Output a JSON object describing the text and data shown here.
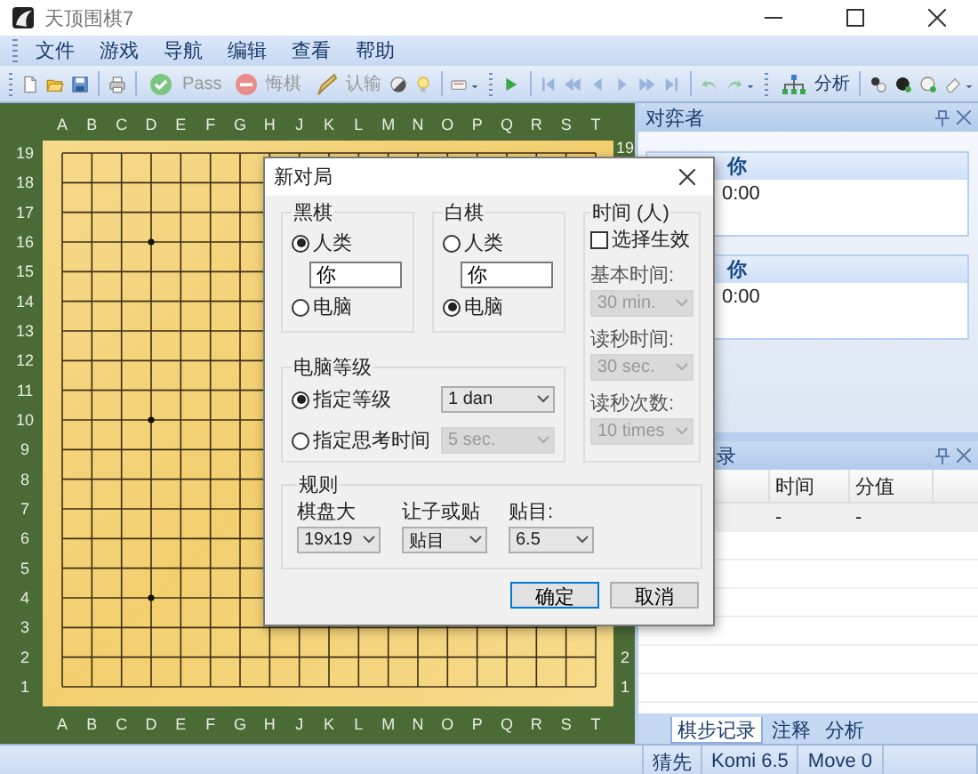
{
  "window": {
    "title": "天顶围棋7"
  },
  "menu": [
    "文件",
    "游戏",
    "导航",
    "编辑",
    "查看",
    "帮助"
  ],
  "toolbar": [
    {
      "label": "Pass",
      "disabled": true
    },
    {
      "label": "悔棋",
      "disabled": true
    },
    {
      "label": "认输",
      "disabled": true
    },
    {
      "label": "分析",
      "disabled": false
    }
  ],
  "board": {
    "top_labels": [
      "A",
      "B",
      "C",
      "D",
      "E",
      "F",
      "G",
      "H",
      "J",
      "K",
      "L",
      "M",
      "N",
      "O",
      "P",
      "Q",
      "R",
      "S",
      "T"
    ],
    "bottom_labels": [
      "A",
      "B",
      "C",
      "D",
      "E",
      "F",
      "G",
      "H",
      "J",
      "K",
      "L",
      "M",
      "N",
      "O",
      "P",
      "Q",
      "R",
      "S",
      "T"
    ],
    "left_labels": [
      "19",
      "18",
      "17",
      "16",
      "15",
      "14",
      "13",
      "12",
      "11",
      "10",
      "9",
      "8",
      "7",
      "6",
      "5",
      "4",
      "3",
      "2",
      "1"
    ],
    "right_labels": [
      "19",
      "2",
      "1"
    ]
  },
  "players_panel": {
    "title": "对弈者",
    "players": [
      {
        "name": "你",
        "time": "0:00"
      },
      {
        "name": "你",
        "time": "0:00"
      }
    ]
  },
  "record_panel": {
    "title": "录",
    "columns": [
      "时间",
      "分值"
    ],
    "rows": [
      [
        "-",
        "-"
      ]
    ],
    "tabs": [
      {
        "label": "棋步记录",
        "selected": true
      },
      {
        "label": "注释",
        "selected": false
      },
      {
        "label": "分析",
        "selected": false
      }
    ]
  },
  "status_bar": [
    "猜先",
    "Komi 6.5",
    "Move 0"
  ],
  "dialog": {
    "title": "新对局",
    "black": {
      "title": "黑棋",
      "options": [
        {
          "label": "人类",
          "selected": true
        },
        {
          "label": "电脑",
          "selected": false
        }
      ],
      "name": "你"
    },
    "white": {
      "title": "白棋",
      "options": [
        {
          "label": "人类",
          "selected": false
        },
        {
          "label": "电脑",
          "selected": true
        }
      ],
      "name": "你"
    },
    "time": {
      "title": "时间 (人)",
      "checkbox": {
        "label": "选择生效",
        "checked": false
      },
      "fields": [
        {
          "label": "基本时间:",
          "value": "30 min.",
          "disabled": true
        },
        {
          "label": "读秒时间:",
          "value": "30 sec.",
          "disabled": true
        },
        {
          "label": "读秒次数:",
          "value": "10 times",
          "disabled": true
        }
      ]
    },
    "computer": {
      "title": "电脑等级",
      "options": [
        {
          "label": "指定等级",
          "selected": true,
          "value": "1 dan",
          "disabled": false
        },
        {
          "label": "指定思考时间",
          "selected": false,
          "value": "5 sec.",
          "disabled": true
        }
      ]
    },
    "rules": {
      "title": "规则",
      "fields": [
        {
          "label": "棋盘大",
          "value": "19x19"
        },
        {
          "label": "让子或贴",
          "value": "贴目"
        },
        {
          "label": "贴目:",
          "value": "6.5"
        }
      ]
    },
    "buttons": [
      {
        "label": "确定",
        "default": true
      },
      {
        "label": "取消",
        "default": false
      }
    ]
  }
}
